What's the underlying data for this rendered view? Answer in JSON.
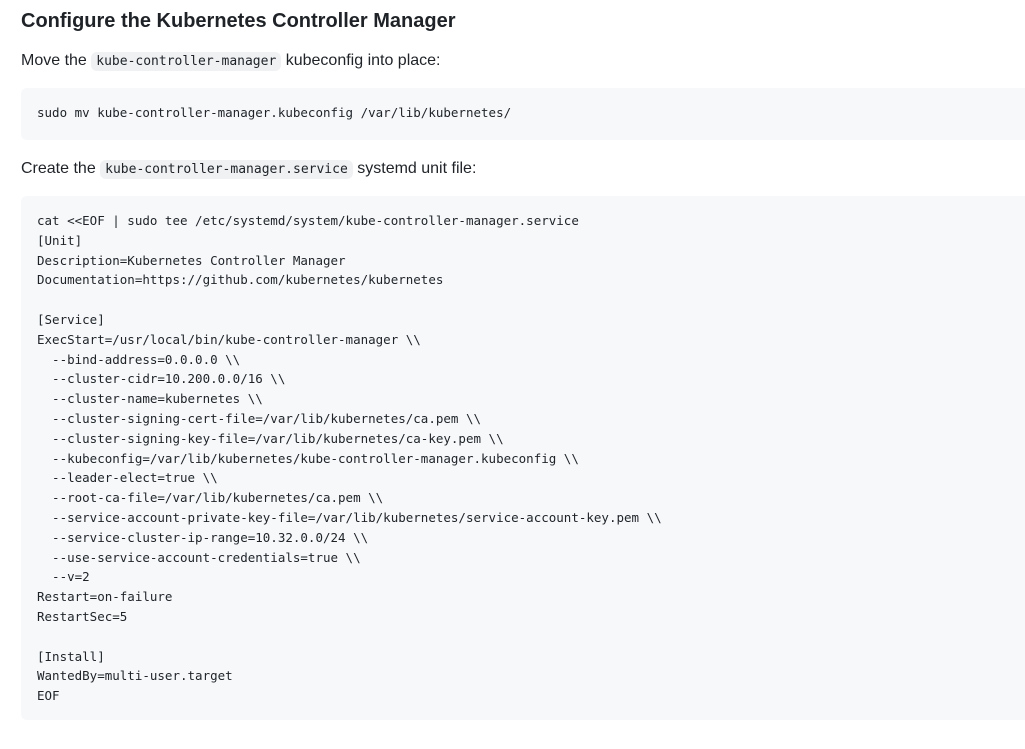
{
  "heading": "Configure the Kubernetes Controller Manager",
  "para1": {
    "before": "Move the ",
    "code": "kube-controller-manager",
    "after": " kubeconfig into place:"
  },
  "code_block_1": "sudo mv kube-controller-manager.kubeconfig /var/lib/kubernetes/",
  "para2": {
    "before": "Create the ",
    "code": "kube-controller-manager.service",
    "after": " systemd unit file:"
  },
  "code_block_2": "cat <<EOF | sudo tee /etc/systemd/system/kube-controller-manager.service\n[Unit]\nDescription=Kubernetes Controller Manager\nDocumentation=https://github.com/kubernetes/kubernetes\n\n[Service]\nExecStart=/usr/local/bin/kube-controller-manager \\\\\n  --bind-address=0.0.0.0 \\\\\n  --cluster-cidr=10.200.0.0/16 \\\\\n  --cluster-name=kubernetes \\\\\n  --cluster-signing-cert-file=/var/lib/kubernetes/ca.pem \\\\\n  --cluster-signing-key-file=/var/lib/kubernetes/ca-key.pem \\\\\n  --kubeconfig=/var/lib/kubernetes/kube-controller-manager.kubeconfig \\\\\n  --leader-elect=true \\\\\n  --root-ca-file=/var/lib/kubernetes/ca.pem \\\\\n  --service-account-private-key-file=/var/lib/kubernetes/service-account-key.pem \\\\\n  --service-cluster-ip-range=10.32.0.0/24 \\\\\n  --use-service-account-credentials=true \\\\\n  --v=2\nRestart=on-failure\nRestartSec=5\n\n[Install]\nWantedBy=multi-user.target\nEOF"
}
